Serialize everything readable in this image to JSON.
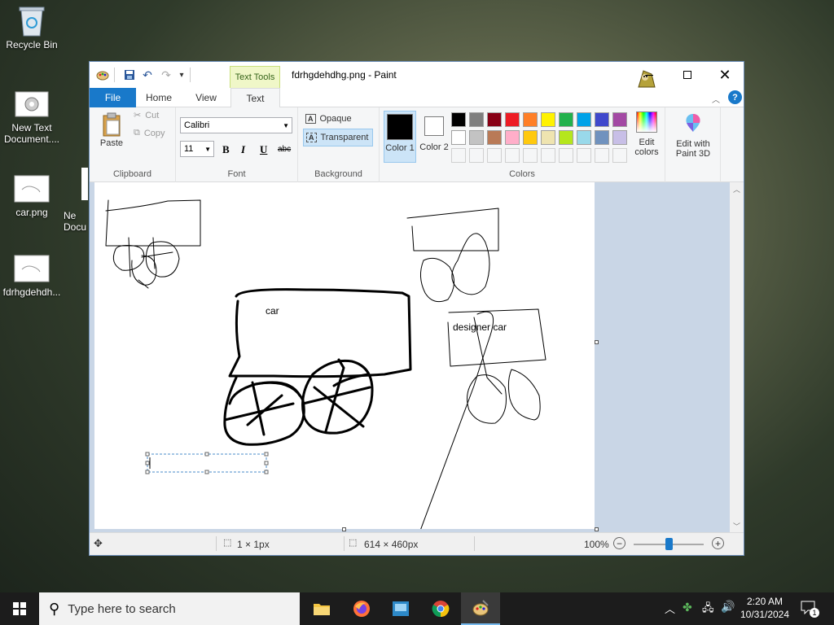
{
  "desktop": {
    "icons": [
      {
        "label": "Recycle Bin"
      },
      {
        "label": "New Text Document...."
      },
      {
        "label": "car.png"
      },
      {
        "label": "fdrhgdehdh..."
      },
      {
        "label": "Ne Docu"
      }
    ]
  },
  "window": {
    "title": "fdrhgdehdhg.png - Paint",
    "context_tab": "Text Tools",
    "tabs": [
      "File",
      "Home",
      "View",
      "Text"
    ],
    "clipboard": {
      "group": "Clipboard",
      "paste": "Paste",
      "cut": "Cut",
      "copy": "Copy"
    },
    "font": {
      "group": "Font",
      "family": "Calibri",
      "size": "11",
      "bold": "B",
      "italic": "I",
      "underline": "U",
      "strike": "abc"
    },
    "background": {
      "group": "Background",
      "opaque": "Opaque",
      "transparent": "Transparent"
    },
    "colors": {
      "group": "Colors",
      "color1_label": "Color 1",
      "color2_label": "Color 2",
      "color1": "#000000",
      "color2": "#ffffff",
      "palette_row1": [
        "#000000",
        "#7f7f7f",
        "#880015",
        "#ed1c24",
        "#ff7f27",
        "#fff200",
        "#22b14c",
        "#00a2e8",
        "#3f48cc",
        "#a349a4"
      ],
      "palette_row2": [
        "#ffffff",
        "#c3c3c3",
        "#b97a57",
        "#ffaec9",
        "#ffc90e",
        "#efe4b0",
        "#b5e61d",
        "#99d9ea",
        "#7092be",
        "#c8bfe7"
      ],
      "edit_colors": "Edit colors",
      "edit_paint3d": "Edit with Paint 3D"
    },
    "canvas_texts": {
      "car": "car",
      "designer_car": "designer car"
    },
    "status": {
      "cursor": "1 × 1px",
      "selection": "614 × 460px",
      "zoom": "100%"
    }
  },
  "taskbar": {
    "search_placeholder": "Type here to search",
    "time": "2:20 AM",
    "date": "10/31/2024",
    "notifications": "1"
  }
}
